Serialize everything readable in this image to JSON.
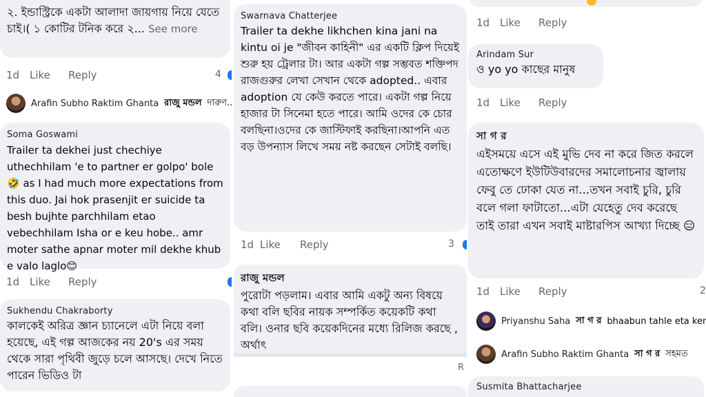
{
  "screens": [
    {
      "id": "left",
      "comments": [
        {
          "text": "২. ইন্ডাস্ট্রিকে একটা আলাদা জায়গায় নিয়ে যেতে চাই।( ১ কোটির টনিক করে ২...",
          "see_more": "See more",
          "actions": {
            "time": "1d",
            "like": "Like",
            "reply": "Reply",
            "count": "4"
          },
          "reply_preview": {
            "name": "Arafin Subho Raktim Ghanta",
            "tag": "রাজু মন্ডল",
            "text": "দারুণ..."
          }
        },
        {
          "author": "Soma Goswami",
          "text": "Trailer ta dekhei just chechiye uthechhilam 'e to partner er golpo' bole🤣 as I had much more expectations from this duo. Jai hok prasenjit er suicide ta besh bujhte parchhilam etao vebechhilam Isha or e keu hobe.. amr moter sathe apnar moter mil dekhe khub e valo laglo😊",
          "actions": {
            "time": "1d",
            "like": "Like",
            "reply": "Reply"
          }
        },
        {
          "author": "Sukhendu Chakraborty",
          "text": "কালকেই অরিত্র জ্ঞান চ্যানেলে এটা নিয়ে বলা হয়েছে, এই গল্প আজকের নয় 20's এর সময় থেকে সারা পৃথিবী জুড়ে চলে আসছে। দেখে নিতে পারেন ভিডিও টা"
        }
      ]
    },
    {
      "id": "middle",
      "comments": [
        {
          "author": "Swarnava Chatterjee",
          "text": "Trailer ta dekhe likhchen kina jani na kintu oi je \"জীবন কাহিনী\" এর একটি ক্লিপ দিয়েই শুরু হয় ট্রেলার টা। আর একটা গল্প সম্ভবত শক্তিপদ রাজগুরুর লেখা সেখান থেকে adopted.. এবার adoption যে কেউ করতে পারে। একটা গল্প নিয়ে হাজার টা সিনেমা হতে পারে। আমি ওদের কে চোর বলছিনা।ওদের কে জাস্টিফাই করছিনা।আপনি এত বড় উপন্যাস লিখে সময় নষ্ট করছেন সেটাই বলছি।",
          "actions": {
            "time": "1d",
            "like": "Like",
            "reply": "Reply",
            "count": "3"
          }
        },
        {
          "author": "রাজু মন্ডল",
          "text": "পুরোটা পড়লাম। এবার আমি একটু অন্য বিষয়ে কথা বলি ছবির নায়ক সম্পর্কিত কয়েকটি কথা বলি। ওনার ছবি কয়েকদিনের মধ্যে রিলিজ করছে , অর্থাৎ",
          "edge_letter": "R"
        }
      ]
    },
    {
      "id": "right",
      "comments": [
        {
          "actions": {
            "time": "1d",
            "like": "Like",
            "reply": "Reply"
          }
        },
        {
          "author": "Arindam Sur",
          "text": "ও yo yo কাছের মানুষ",
          "actions": {
            "time": "1d",
            "like": "Like",
            "reply": "Reply"
          }
        },
        {
          "author": "সা গ র",
          "text": "এইসময়ে এসে এই মুভি দেব না করে জিত করলে এতোক্ষণে ইউটিউবারদের সমালোচনার জ্বালায় ফেবু তে ঢোকা যেত না...তখন সবাই চুরি, চুরি বলে গলা ফাটাতো...এটা যেহেতু দেব করেছে তাই তারা এখন সবাই মাষ্টারপিস আখ্যা দিচ্ছে 😑",
          "actions": {
            "time": "1d",
            "like": "Like",
            "reply": "Reply",
            "count": "2"
          },
          "replies": [
            {
              "name": "Priyanshu Saha",
              "tag": "সা গ র",
              "text": "bhaabun tahle eta keno"
            },
            {
              "name": "Arafin Subho Raktim Ghanta",
              "tag": "সা গ র",
              "text": "সহমত"
            }
          ]
        },
        {
          "author": "Susmita Bhattacharjee"
        }
      ]
    }
  ],
  "colors": {
    "bubble": "#eef0f3",
    "meta": "#65676b",
    "reaction_blue": "#1877f2",
    "reaction_orange": "#f7b928"
  }
}
